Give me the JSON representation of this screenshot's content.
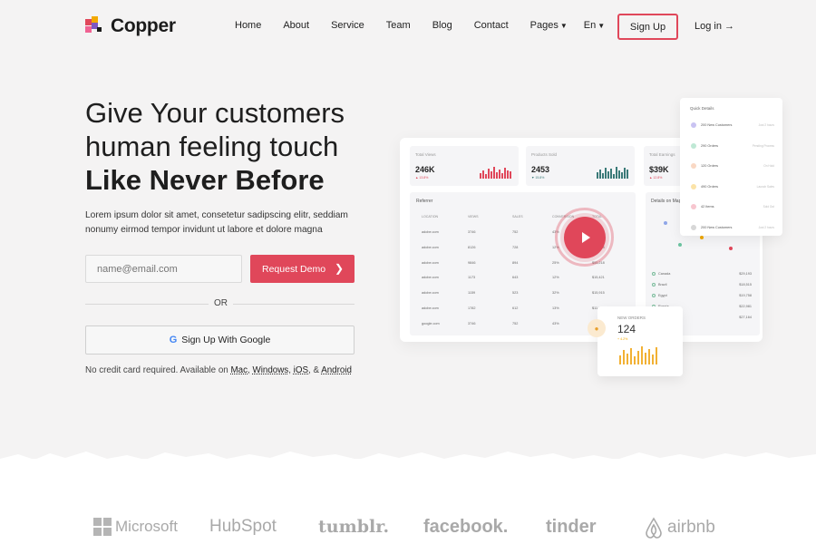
{
  "nav": {
    "brand": "Copper",
    "menu": [
      "Home",
      "About",
      "Service",
      "Team",
      "Blog",
      "Contact",
      "Pages",
      "En"
    ],
    "signup_label": "Sign Up",
    "login_label": "Log in →"
  },
  "hero": {
    "title_line1": "Give Your customers",
    "title_line2": "human feeling touch",
    "title_line3": "Like Never Before",
    "description": "Lorem ipsum dolor sit amet, consetetur sadipscing elitr, seddiam nonumy eirmod tempor invidunt ut labore et dolore magna",
    "email_placeholder": "name@email.com",
    "demo_label": "Request Demo",
    "or_label": "OR",
    "google_label": "Sign Up With Google",
    "note_prefix": "No credit card required. Available on ",
    "platforms": [
      "Mac",
      "Windows",
      "iOS",
      "Android"
    ],
    "note_and": "&"
  },
  "dashboard": {
    "total_views_label": "Total Views",
    "total_views": "246K",
    "total_views_change": "▲ 13.8%",
    "products_sold_label": "Products Sold",
    "products_sold": "2453",
    "products_sold_change": "▼ 15.8%",
    "total_earnings_label": "Total Earnings",
    "total_earnings": "$39K",
    "total_earnings_change": "▲ 12.8%",
    "referrer_title": "Referrer",
    "referrer_columns": [
      "LOCATION",
      "VIEWS",
      "SALES",
      "CONVERSION",
      "TOTAL"
    ],
    "referrer_rows": [
      [
        "adobe.com",
        "3746",
        "752",
        "43%",
        "$75,297"
      ],
      [
        "adobe.com",
        "8126",
        "728",
        "12%",
        "$71,438"
      ],
      [
        "adobe.com",
        "9846",
        "894",
        "25%",
        "$55,218"
      ],
      [
        "adobe.com",
        "1173",
        "643",
        "12%",
        "$15,421"
      ],
      [
        "adobe.com",
        "1159",
        "523",
        "32%",
        "$15,915"
      ],
      [
        "adobe.com",
        "1782",
        "612",
        "13%",
        "$11,842"
      ],
      [
        "google.com",
        "3746",
        "752",
        "43%",
        "$75,297"
      ]
    ],
    "map_title": "Details on Map",
    "countries": [
      [
        "Canada",
        "$29,193"
      ],
      [
        "Brazil",
        "$18,515"
      ],
      [
        "Egypt",
        "$19,758"
      ],
      [
        "Russia",
        "$22,981"
      ],
      [
        "Russia",
        "$27,164"
      ]
    ],
    "quick_title": "Quick Details",
    "quick_items": [
      [
        "200 New Customers",
        "Just 2 hours"
      ],
      [
        "290 Orders",
        "Pending Process"
      ],
      [
        "120 Orders",
        "On Hold"
      ],
      [
        "490 Orders",
        "Launch Sales"
      ],
      [
        "42 Items",
        "Sold Out"
      ],
      [
        "200 New Customers",
        "Just 2 hours"
      ]
    ],
    "new_orders_label": "NEW ORDERS",
    "new_orders": "124",
    "new_orders_change": "+ 4.2%"
  },
  "brands": [
    "Microsoft",
    "HubSpot",
    "tumblr.",
    "facebook.",
    "tinder",
    "airbnb"
  ],
  "colors": {
    "accent": "#e0475a",
    "bars_red": "#e0475a",
    "bars_teal": "#3a7a78",
    "bars_gold": "#f2b134"
  }
}
